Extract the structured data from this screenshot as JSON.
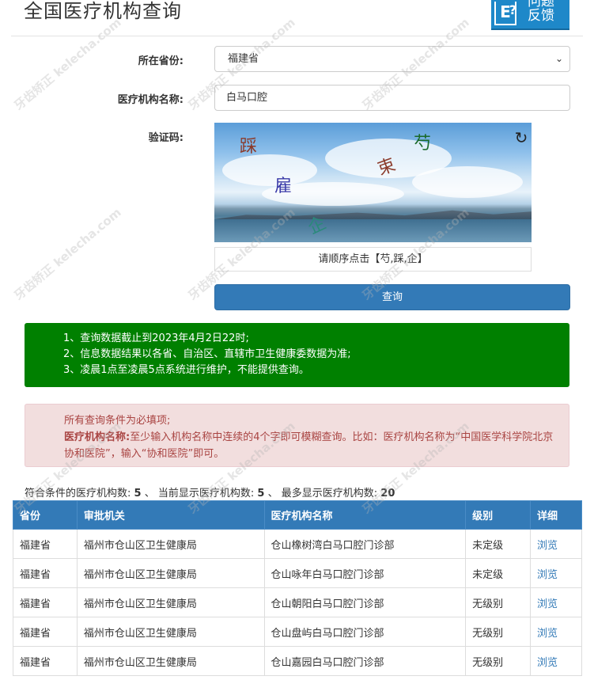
{
  "page": {
    "title": "全国医疗机构查询"
  },
  "feedback": {
    "line1": "问题",
    "line2": "反馈"
  },
  "form": {
    "province_label": "所在省份:",
    "province_value": "福建省",
    "name_label": "医疗机构名称:",
    "name_value": "白马口腔",
    "captcha_label": "验证码:",
    "captcha_chars": [
      "踩",
      "雇",
      "企",
      "束",
      "芍"
    ],
    "captcha_hint": "请顺序点击【芍,踩,企】",
    "submit_label": "查询"
  },
  "notices": {
    "info": [
      "1、查询数据截止到2023年4月2日22时;",
      "2、信息数据结果以各省、自治区、直辖市卫生健康委数据为准;",
      "3、凌晨1点至凌晨5点系统进行维护，不能提供查询。"
    ],
    "warning_line1": "所有查询条件为必填项;",
    "warning_bold": "医疗机构名称:",
    "warning_text": "至少输入机构名称中连续的4个字即可模糊查询。比如：医疗机构名称为“中国医学科学院北京协和医院”，输入“协和医院”即可。"
  },
  "summary": {
    "matched_label": "符合条件的医疗机构数:",
    "matched": "5",
    "shown_label": "当前显示医疗机构数:",
    "shown": "5",
    "max_label": "最多显示医疗机构数:",
    "max": "20",
    "sep": "、"
  },
  "table": {
    "headers": [
      "省份",
      "审批机关",
      "医疗机构名称",
      "级别",
      "详细"
    ],
    "rows": [
      [
        "福建省",
        "福州市仓山区卫生健康局",
        "仓山橡树湾白马口腔门诊部",
        "未定级",
        "浏览"
      ],
      [
        "福建省",
        "福州市仓山区卫生健康局",
        "仓山咏年白马口腔门诊部",
        "未定级",
        "浏览"
      ],
      [
        "福建省",
        "福州市仓山区卫生健康局",
        "仓山朝阳白马口腔门诊部",
        "无级别",
        "浏览"
      ],
      [
        "福建省",
        "福州市仓山区卫生健康局",
        "仓山盘屿白马口腔门诊部",
        "无级别",
        "浏览"
      ],
      [
        "福建省",
        "福州市仓山区卫生健康局",
        "仓山嘉园白马口腔门诊部",
        "无级别",
        "浏览"
      ]
    ]
  },
  "watermark": {
    "text": "牙齿矫正 kelecha.com"
  },
  "colors": {
    "primary": "#337ab7",
    "success": "#008000",
    "danger_bg": "#f2dede",
    "danger_text": "#a94442"
  }
}
